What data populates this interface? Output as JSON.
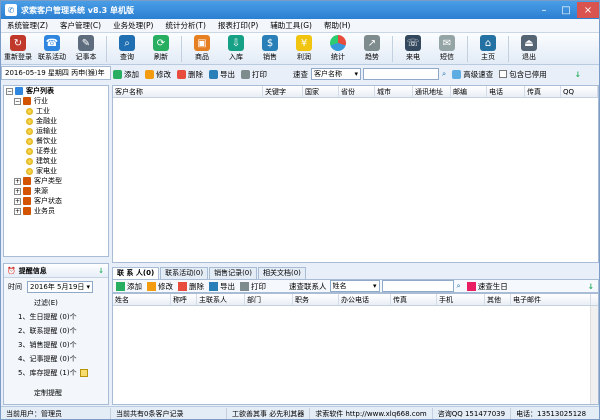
{
  "window": {
    "title": "求索客户管理系统 v8.3 单机版"
  },
  "menu": [
    "系统管理(Z)",
    "客户管理(C)",
    "业务处理(P)",
    "统计分析(T)",
    "报表打印(P)",
    "辅助工具(G)",
    "帮助(H)"
  ],
  "toolbar": [
    {
      "label": "重新登录",
      "icon": "login-icon",
      "color": "#c0392b"
    },
    {
      "label": "联系活动",
      "icon": "activity-icon",
      "color": "#2e86de"
    },
    {
      "label": "记事本",
      "icon": "notebook-icon",
      "color": "#5d6d7e"
    },
    {
      "label": "查询",
      "icon": "search-icon",
      "color": "#1f6fb2"
    },
    {
      "label": "刷新",
      "icon": "refresh-icon",
      "color": "#27ae60"
    },
    {
      "label": "商品",
      "icon": "goods-icon",
      "color": "#e67e22"
    },
    {
      "label": "入库",
      "icon": "stock-in-icon",
      "color": "#16a085"
    },
    {
      "label": "销售",
      "icon": "sales-icon",
      "color": "#2980b9"
    },
    {
      "label": "利润",
      "icon": "profit-icon",
      "color": "#f1c40f"
    },
    {
      "label": "统计",
      "icon": "stats-pie-icon",
      "color": "#8e44ad"
    },
    {
      "label": "趋势",
      "icon": "trend-icon",
      "color": "#7f8c8d"
    },
    {
      "label": "来电",
      "icon": "call-icon",
      "color": "#34495e"
    },
    {
      "label": "短信",
      "icon": "sms-icon",
      "color": "#95a5a6"
    },
    {
      "label": "主页",
      "icon": "home-icon",
      "color": "#2471a3"
    },
    {
      "label": "退出",
      "icon": "exit-icon",
      "color": "#566573"
    }
  ],
  "date_display": "2016-05-19 星期四 丙申(猴)年",
  "list_actions": [
    "添加",
    "修改",
    "删除",
    "导出",
    "打印"
  ],
  "search": {
    "label": "速查",
    "field": "客户名称",
    "advanced": "高级速查",
    "include_disabled": "包含已停用"
  },
  "tree": {
    "root": "客户列表",
    "industry": "行业",
    "industries": [
      "工业",
      "金融业",
      "运输业",
      "餐饮业",
      "证券业",
      "建筑业",
      "家电业"
    ],
    "others": [
      "客户类型",
      "来源",
      "客户状态",
      "业务员"
    ]
  },
  "main_columns": [
    "客户名称",
    "关键字",
    "国家",
    "省份",
    "城市",
    "通讯地址",
    "邮编",
    "电话",
    "传真",
    "QQ"
  ],
  "reminder": {
    "title": "提醒信息",
    "time_label": "时间",
    "date": "2016年 5月19日",
    "overdue": "过滤(E)",
    "items": [
      "1、生日提醒 (0)个",
      "2、联系提醒 (0)个",
      "3、销售提醒 (0)个",
      "4、记事提醒 (0)个",
      "5、库存提醒 (1)个"
    ],
    "custom": "定制提醒"
  },
  "tabs": [
    "联 系 人(0)",
    "联系活动(0)",
    "销售记录(0)",
    "相关文档(0)"
  ],
  "contact_search": {
    "label": "速查联系人",
    "field": "姓名",
    "button": "速查生日"
  },
  "contact_columns": [
    "姓名",
    "称呼",
    "主联系人",
    "部门",
    "职务",
    "办公电话",
    "传真",
    "手机",
    "其他",
    "电子邮件"
  ],
  "status": [
    "当前用户：管理员",
    "当前共有0条客户记录",
    "工欲善其事 必先利其器",
    "求索软件 http://www.xlq668.com",
    "咨询QQ 151477039",
    "电话：13513025128"
  ]
}
